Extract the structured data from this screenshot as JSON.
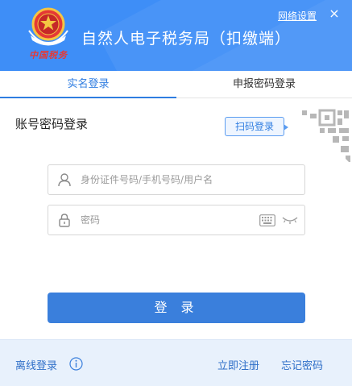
{
  "header": {
    "title": "自然人电子税务局（扣缴端）",
    "network_settings": "网络设置",
    "close_glyph": "×",
    "brand_signature": "中国税务",
    "colors": {
      "header_bg": "#3e8ef7",
      "accent": "#2f7de1",
      "emblem_red": "#e53935",
      "emblem_gold": "#f4c542"
    }
  },
  "tabs": [
    {
      "label": "实名登录",
      "active": true
    },
    {
      "label": "申报密码登录",
      "active": false
    }
  ],
  "login": {
    "heading": "账号密码登录",
    "scan_button": "扫码登录",
    "username_placeholder": "身份证件号码/手机号码/用户名",
    "username_value": "",
    "password_placeholder": "密码",
    "password_value": "",
    "submit": "登 录"
  },
  "footer": {
    "offline": "离线登录",
    "register": "立即注册",
    "forgot": "忘记密码"
  },
  "icons": [
    "emblem-icon",
    "close-icon",
    "qr-code-icon",
    "user-icon",
    "lock-icon",
    "keyboard-icon",
    "eye-closed-icon",
    "info-icon"
  ]
}
